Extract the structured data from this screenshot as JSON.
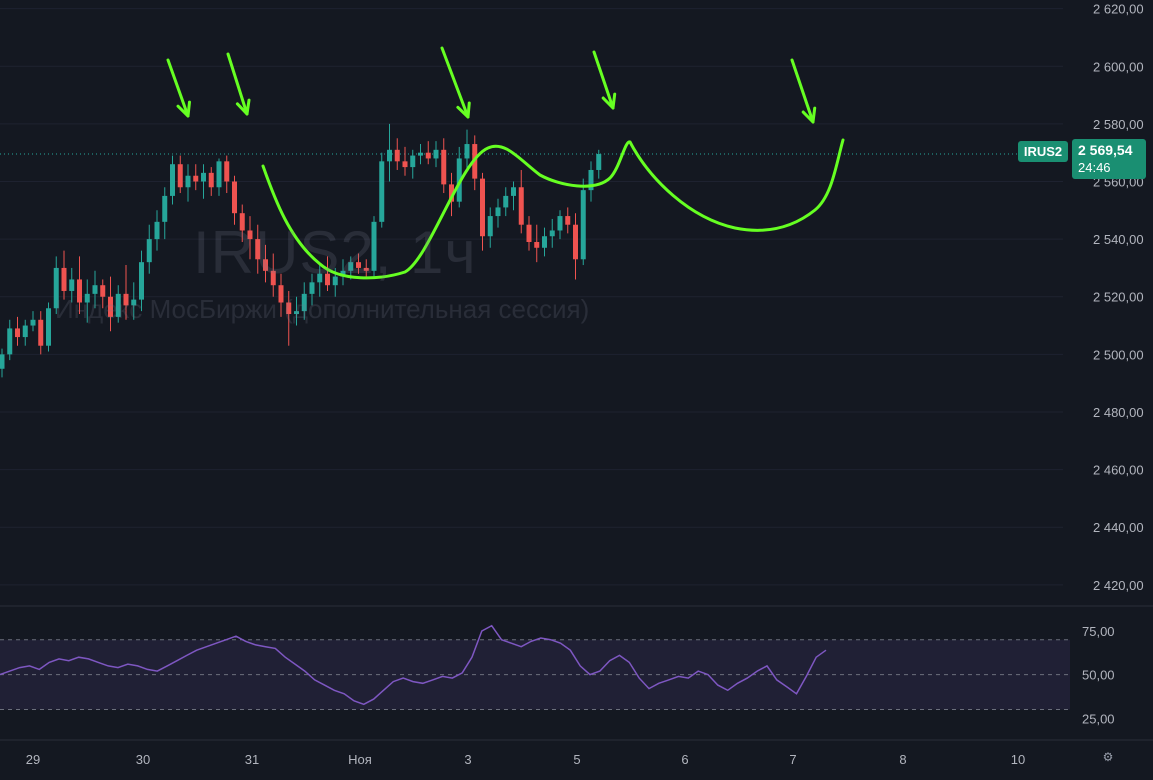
{
  "watermark": {
    "symbol_text": "IRUS2, 1ч",
    "description_text": "Индекс МосБиржи (дополнительная сессия)"
  },
  "last_price": {
    "ticker": "IRUS2",
    "price": "2 569,54",
    "countdown": "24:46",
    "color": "#1a8f72"
  },
  "settings_icon": "gear-icon",
  "chart_data": [
    {
      "type": "candlestick",
      "timeframe": "1h",
      "price_axis_labels": [
        "2 620,00",
        "2 600,00",
        "2 580,00",
        "2 560,00",
        "2 540,00",
        "2 520,00",
        "2 500,00",
        "2 480,00",
        "2 460,00",
        "2 440,00",
        "2 420,00"
      ],
      "price_axis_values": [
        2620,
        2600,
        2580,
        2560,
        2540,
        2520,
        2500,
        2480,
        2460,
        2440,
        2420
      ],
      "ylim": [
        2413,
        2623
      ],
      "x_labels": [
        "29",
        "30",
        "31",
        "Ноя",
        "3",
        "5",
        "6",
        "7",
        "8",
        "10"
      ],
      "x_count": 78,
      "x_label_positions": [
        0,
        14,
        28,
        41,
        55,
        69,
        83,
        97,
        111,
        125
      ],
      "candles": [
        [
          2495,
          2502,
          2492,
          2500
        ],
        [
          2500,
          2512,
          2498,
          2509
        ],
        [
          2509,
          2513,
          2503,
          2506
        ],
        [
          2506,
          2512,
          2503,
          2510
        ],
        [
          2510,
          2515,
          2508,
          2512
        ],
        [
          2512,
          2515,
          2500,
          2503
        ],
        [
          2503,
          2518,
          2501,
          2516
        ],
        [
          2516,
          2534,
          2514,
          2530
        ],
        [
          2530,
          2536,
          2519,
          2522
        ],
        [
          2522,
          2530,
          2518,
          2526
        ],
        [
          2526,
          2534,
          2514,
          2518
        ],
        [
          2518,
          2526,
          2511,
          2521
        ],
        [
          2521,
          2529,
          2516,
          2524
        ],
        [
          2524,
          2526,
          2516,
          2520
        ],
        [
          2520,
          2527,
          2508,
          2513
        ],
        [
          2513,
          2524,
          2511,
          2521
        ],
        [
          2521,
          2531,
          2512,
          2517
        ],
        [
          2517,
          2525,
          2512,
          2519
        ],
        [
          2519,
          2536,
          2515,
          2532
        ],
        [
          2532,
          2545,
          2528,
          2540
        ],
        [
          2540,
          2550,
          2536,
          2546
        ],
        [
          2546,
          2558,
          2540,
          2555
        ],
        [
          2555,
          2569,
          2552,
          2566
        ],
        [
          2566,
          2569,
          2556,
          2558
        ],
        [
          2558,
          2566,
          2553,
          2562
        ],
        [
          2562,
          2566,
          2557,
          2560
        ],
        [
          2560,
          2566,
          2554,
          2563
        ],
        [
          2563,
          2565,
          2555,
          2558
        ],
        [
          2558,
          2568,
          2555,
          2567
        ],
        [
          2567,
          2569,
          2556,
          2560
        ],
        [
          2560,
          2562,
          2545,
          2549
        ],
        [
          2549,
          2552,
          2539,
          2543
        ],
        [
          2543,
          2548,
          2533,
          2540
        ],
        [
          2540,
          2545,
          2528,
          2533
        ],
        [
          2533,
          2538,
          2525,
          2529
        ],
        [
          2529,
          2535,
          2520,
          2524
        ],
        [
          2524,
          2528,
          2513,
          2518
        ],
        [
          2518,
          2522,
          2503,
          2514
        ],
        [
          2514,
          2520,
          2510,
          2515
        ],
        [
          2515,
          2525,
          2512,
          2521
        ],
        [
          2521,
          2528,
          2517,
          2525
        ],
        [
          2525,
          2531,
          2520,
          2528
        ],
        [
          2528,
          2534,
          2522,
          2524
        ],
        [
          2524,
          2530,
          2520,
          2527
        ],
        [
          2527,
          2533,
          2524,
          2529
        ],
        [
          2529,
          2534,
          2526,
          2532
        ],
        [
          2532,
          2535,
          2528,
          2530
        ],
        [
          2530,
          2533,
          2527,
          2529
        ],
        [
          2529,
          2548,
          2527,
          2546
        ],
        [
          2546,
          2570,
          2544,
          2567
        ],
        [
          2567,
          2580,
          2560,
          2571
        ],
        [
          2571,
          2575,
          2564,
          2567
        ],
        [
          2567,
          2572,
          2562,
          2565
        ],
        [
          2565,
          2571,
          2561,
          2569
        ],
        [
          2569,
          2573,
          2566,
          2570
        ],
        [
          2570,
          2574,
          2566,
          2568
        ],
        [
          2568,
          2574,
          2565,
          2571
        ],
        [
          2571,
          2575,
          2556,
          2559
        ],
        [
          2559,
          2563,
          2548,
          2553
        ],
        [
          2553,
          2572,
          2551,
          2568
        ],
        [
          2568,
          2578,
          2564,
          2573
        ],
        [
          2573,
          2576,
          2557,
          2561
        ],
        [
          2561,
          2563,
          2536,
          2541
        ],
        [
          2541,
          2551,
          2537,
          2548
        ],
        [
          2548,
          2554,
          2544,
          2551
        ],
        [
          2551,
          2558,
          2548,
          2555
        ],
        [
          2555,
          2560,
          2550,
          2558
        ],
        [
          2558,
          2564,
          2542,
          2545
        ],
        [
          2545,
          2548,
          2536,
          2539
        ],
        [
          2539,
          2545,
          2532,
          2537
        ],
        [
          2537,
          2544,
          2534,
          2541
        ],
        [
          2541,
          2547,
          2537,
          2543
        ],
        [
          2543,
          2550,
          2540,
          2548
        ],
        [
          2548,
          2551,
          2542,
          2545
        ],
        [
          2545,
          2549,
          2526,
          2533
        ],
        [
          2533,
          2561,
          2531,
          2557
        ],
        [
          2557,
          2567,
          2553,
          2564
        ],
        [
          2564,
          2571,
          2561,
          2569.54
        ]
      ]
    },
    {
      "type": "line",
      "indicator": "rsi",
      "axis_labels": [
        "75,00",
        "50,00",
        "25,00"
      ],
      "axis_values": [
        75,
        50,
        25
      ],
      "ylim": [
        20,
        83
      ],
      "band": [
        30,
        70
      ],
      "color": "#7e57c2",
      "values": [
        50,
        52,
        54,
        55,
        53,
        57,
        59,
        58,
        60,
        59,
        57,
        55,
        54,
        56,
        55,
        53,
        52,
        55,
        58,
        61,
        64,
        66,
        68,
        70,
        72,
        69,
        67,
        66,
        65,
        60,
        56,
        52,
        47,
        44,
        41,
        39,
        35,
        33,
        36,
        41,
        46,
        48,
        46,
        45,
        47,
        49,
        48,
        51,
        60,
        75,
        78,
        70,
        68,
        66,
        69,
        71,
        70,
        68,
        64,
        55,
        50,
        52,
        58,
        61,
        57,
        48,
        42,
        45,
        47,
        49,
        48,
        52,
        50,
        44,
        41,
        45,
        48,
        52,
        55,
        47,
        43,
        39,
        49,
        60,
        64
      ]
    }
  ]
}
